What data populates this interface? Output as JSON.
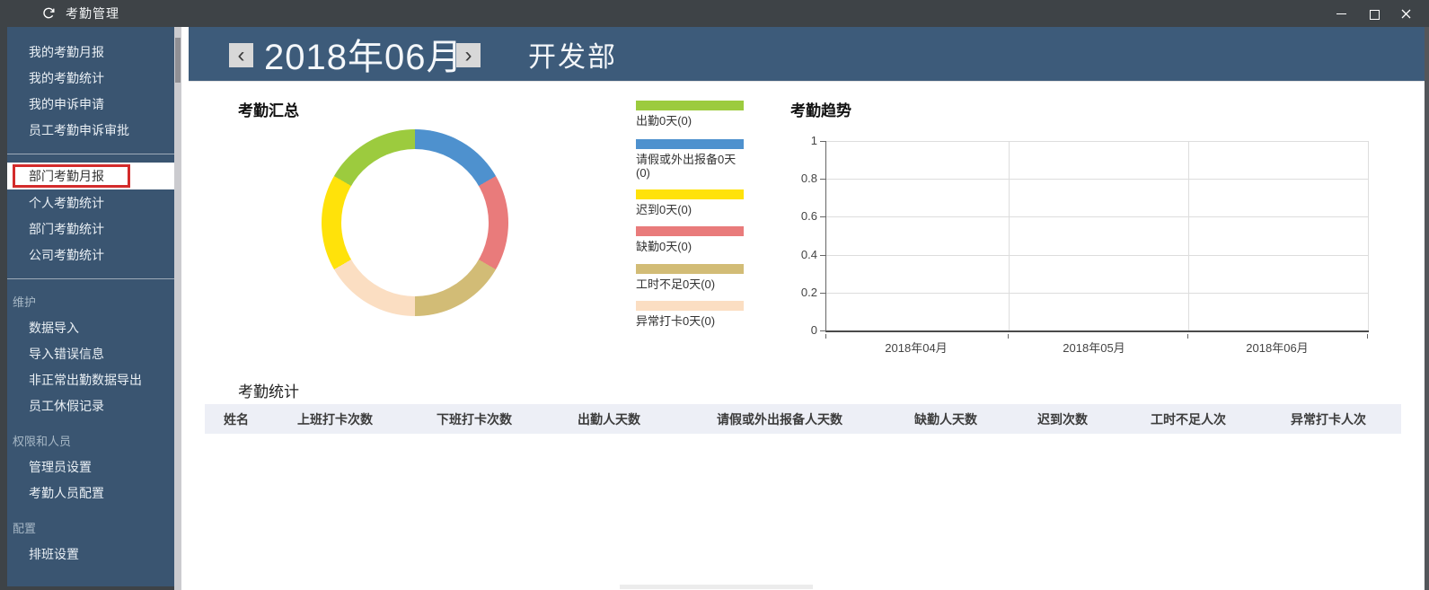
{
  "window": {
    "title": "考勤管理"
  },
  "sidebar": {
    "selected": "部门考勤月报",
    "items": [
      {
        "label": "我的考勤月报",
        "type": "item"
      },
      {
        "label": "我的考勤统计",
        "type": "item"
      },
      {
        "label": "我的申诉申请",
        "type": "item"
      },
      {
        "label": "员工考勤申诉审批",
        "type": "item"
      },
      {
        "label": "部门考勤月报",
        "type": "item",
        "selected": true
      },
      {
        "label": "个人考勤统计",
        "type": "item"
      },
      {
        "label": "部门考勤统计",
        "type": "item"
      },
      {
        "label": "公司考勤统计",
        "type": "item"
      },
      {
        "label": "维护",
        "type": "section"
      },
      {
        "label": "数据导入",
        "type": "item"
      },
      {
        "label": "导入错误信息",
        "type": "item"
      },
      {
        "label": "非正常出勤数据导出",
        "type": "item"
      },
      {
        "label": "员工休假记录",
        "type": "item"
      },
      {
        "label": "权限和人员",
        "type": "section"
      },
      {
        "label": "管理员设置",
        "type": "item"
      },
      {
        "label": "考勤人员配置",
        "type": "item"
      },
      {
        "label": "配置",
        "type": "section"
      },
      {
        "label": "排班设置",
        "type": "item"
      }
    ]
  },
  "header": {
    "prev": "‹",
    "next": "›",
    "date": "2018年06月",
    "department": "开发部"
  },
  "chart_data": [
    {
      "type": "pie",
      "subtype": "donut",
      "title": "考勤汇总",
      "categories": [
        "出勤",
        "请假或外出报备",
        "迟到",
        "缺勤",
        "工时不足",
        "异常打卡"
      ],
      "values": [
        0,
        0,
        0,
        0,
        0,
        0
      ],
      "value_unit": "天",
      "legend_labels": [
        "出勤0天(0)",
        "请假或外出报备0天(0)",
        "迟到0天(0)",
        "缺勤0天(0)",
        "工时不足0天(0)",
        "异常打卡0天(0)"
      ],
      "colors": [
        "#9CCB3E",
        "#4E91CE",
        "#FFE20A",
        "#E97B7B",
        "#D2BC76",
        "#FBDEC2"
      ],
      "segments_clockwise_from_top": [
        {
          "category": "请假或外出报备",
          "color": "#4E91CE",
          "sweep_deg": 60
        },
        {
          "category": "缺勤",
          "color": "#E97B7B",
          "sweep_deg": 60
        },
        {
          "category": "工时不足",
          "color": "#D2BC76",
          "sweep_deg": 60
        },
        {
          "category": "异常打卡",
          "color": "#FBDEC2",
          "sweep_deg": 60
        },
        {
          "category": "迟到",
          "color": "#FFE20A",
          "sweep_deg": 60
        },
        {
          "category": "出勤",
          "color": "#9CCB3E",
          "sweep_deg": 60
        }
      ],
      "legend_position": "right"
    },
    {
      "type": "line",
      "title": "考勤趋势",
      "x": [
        "2018年04月",
        "2018年05月",
        "2018年06月"
      ],
      "series": [],
      "ylim": [
        0,
        1
      ],
      "yticks": [
        0,
        0.2,
        0.4,
        0.6,
        0.8,
        1
      ],
      "grid": true
    }
  ],
  "stats": {
    "title": "考勤统计",
    "headers": [
      "姓名",
      "上班打卡次数",
      "下班打卡次数",
      "出勤人天数",
      "请假或外出报备人天数",
      "缺勤人天数",
      "迟到次数",
      "工时不足人次",
      "异常打卡人次"
    ],
    "rows": []
  }
}
